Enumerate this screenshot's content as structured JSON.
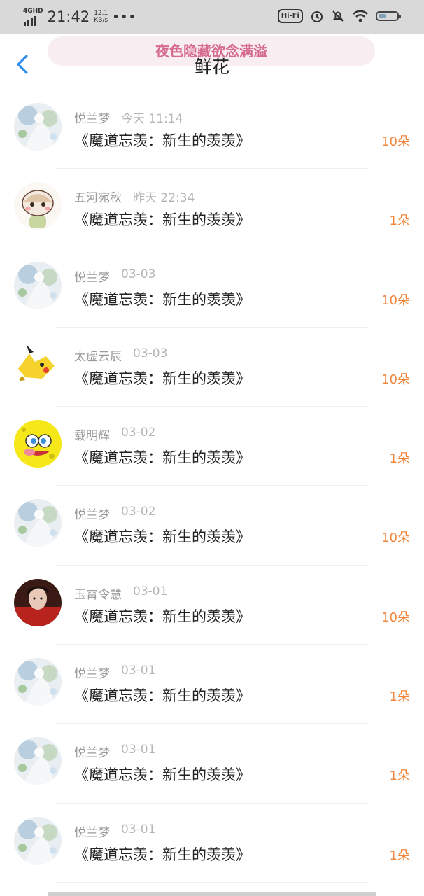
{
  "status_bar": {
    "network": "4GHD",
    "time": "21:42",
    "speed_value": "12.1",
    "speed_unit": "KB/s",
    "more": "•••",
    "hifi": "Hi-Fi",
    "battery_level": 0.4
  },
  "header": {
    "promo_text": "夜色隐藏欲念满溢",
    "title": "鲜花"
  },
  "items": [
    {
      "name": "悦兰梦",
      "time": "今天 11:14",
      "title": "《魔道忘羡：新生的羡羡》",
      "count": "10朵",
      "avatar": "avatar-floral"
    },
    {
      "name": "五河宛秋",
      "time": "昨天 22:34",
      "title": "《魔道忘羡：新生的羡羡》",
      "count": "1朵",
      "avatar": "avatar-cartoon-bear"
    },
    {
      "name": "悦兰梦",
      "time": "03-03",
      "title": "《魔道忘羡：新生的羡羡》",
      "count": "10朵",
      "avatar": "avatar-floral"
    },
    {
      "name": "太虚云辰",
      "time": "03-03",
      "title": "《魔道忘羡：新生的羡羡》",
      "count": "10朵",
      "avatar": "avatar-pikachu"
    },
    {
      "name": "载明辉",
      "time": "03-02",
      "title": "《魔道忘羡：新生的羡羡》",
      "count": "1朵",
      "avatar": "avatar-sponge"
    },
    {
      "name": "悦兰梦",
      "time": "03-02",
      "title": "《魔道忘羡：新生的羡羡》",
      "count": "10朵",
      "avatar": "avatar-floral"
    },
    {
      "name": "玉霄令慧",
      "time": "03-01",
      "title": "《魔道忘羡：新生的羡羡》",
      "count": "10朵",
      "avatar": "avatar-photo"
    },
    {
      "name": "悦兰梦",
      "time": "03-01",
      "title": "《魔道忘羡：新生的羡羡》",
      "count": "1朵",
      "avatar": "avatar-floral"
    },
    {
      "name": "悦兰梦",
      "time": "03-01",
      "title": "《魔道忘羡：新生的羡羡》",
      "count": "1朵",
      "avatar": "avatar-floral"
    },
    {
      "name": "悦兰梦",
      "time": "03-01",
      "title": "《魔道忘羡：新生的羡羡》",
      "count": "1朵",
      "avatar": "avatar-floral"
    }
  ],
  "colors": {
    "accent_count": "#f0853a",
    "promo_text": "#d66a8f",
    "back_arrow": "#2f8cf0"
  }
}
